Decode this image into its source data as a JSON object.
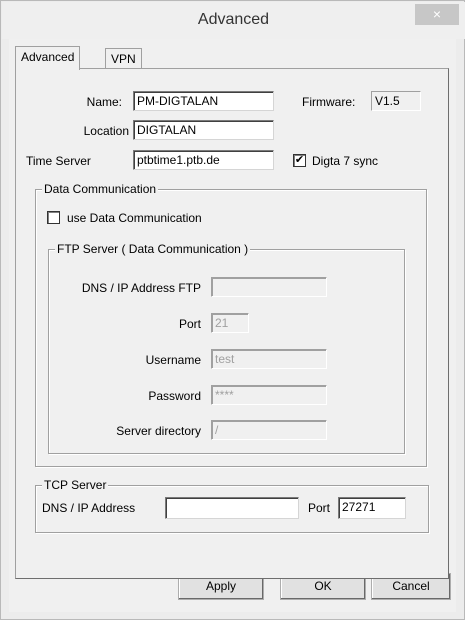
{
  "window": {
    "title": "Advanced",
    "close_glyph": "×"
  },
  "tabs": [
    {
      "label": "Advanced",
      "active": true
    },
    {
      "label": "VPN",
      "active": false
    }
  ],
  "general": {
    "name_label": "Name:",
    "name_value": "PM-DIGTALAN",
    "firmware_label": "Firmware:",
    "firmware_value": "V1.5",
    "location_label": "Location",
    "location_value": "DIGTALAN",
    "time_server_label": "Time Server",
    "time_server_value": "ptbtime1.ptb.de",
    "digta_sync_label": "Digta 7 sync",
    "digta_sync_checked": true
  },
  "data_comm": {
    "group_title": "Data Communication",
    "use_label": "use Data Communication",
    "use_checked": false,
    "ftp": {
      "group_title": "FTP Server ( Data Communication )",
      "dns_label": "DNS / IP Address FTP",
      "dns_value": "",
      "port_label": "Port",
      "port_value": "21",
      "username_label": "Username",
      "username_value": "test",
      "password_label": "Password",
      "password_value": "****",
      "directory_label": "Server directory",
      "directory_value": "/"
    }
  },
  "tcp": {
    "group_title": "TCP Server",
    "dns_label": "DNS / IP Address",
    "dns_value": "",
    "port_label": "Port",
    "port_value": "27271"
  },
  "buttons": {
    "apply": "Apply",
    "ok": "OK",
    "cancel": "Cancel"
  },
  "icons": {
    "checkmark": "✔"
  }
}
